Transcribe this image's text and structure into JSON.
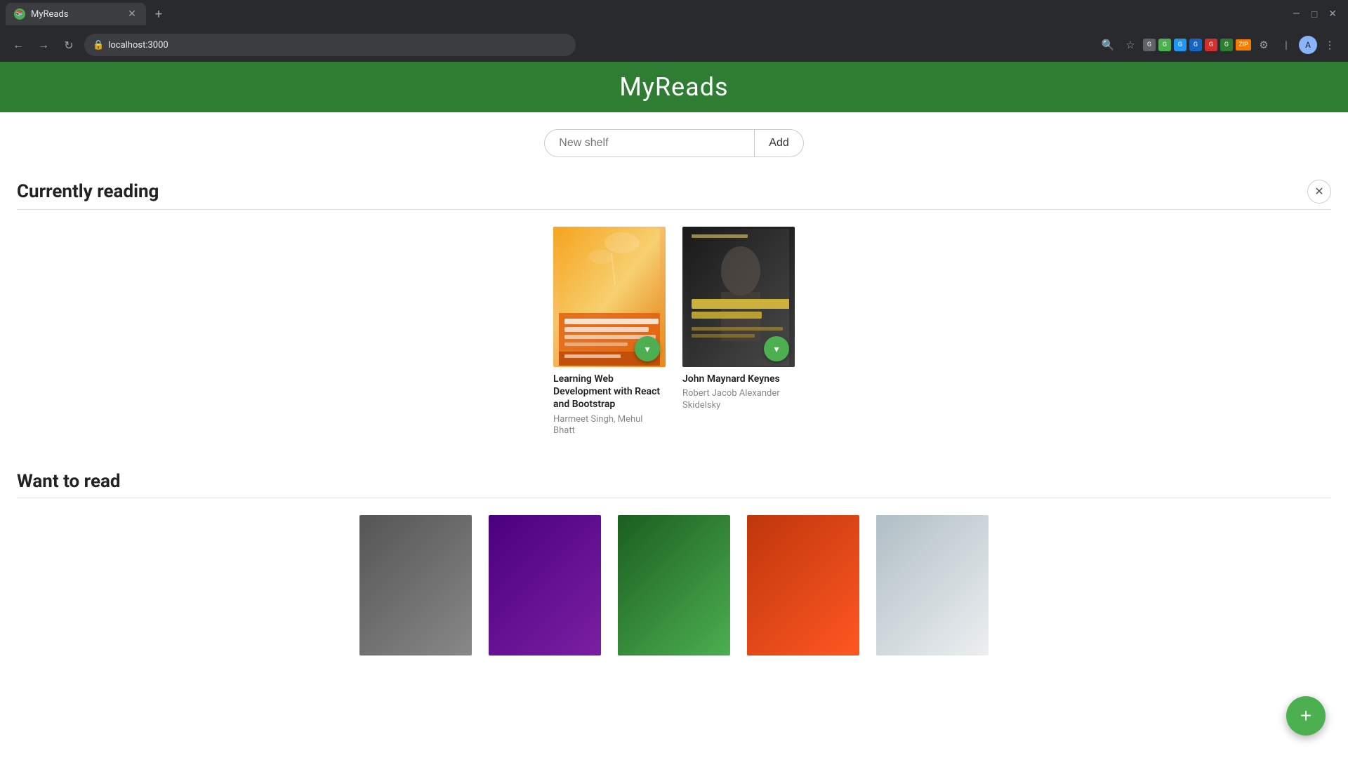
{
  "browser": {
    "tab_title": "MyReads",
    "tab_favicon": "📚",
    "address": "localhost:3000",
    "window_minimize": "—",
    "window_maximize": "□",
    "window_close": "✕"
  },
  "app": {
    "title": "MyReads",
    "header_bg": "#2e7d32"
  },
  "new_shelf": {
    "placeholder": "New shelf",
    "add_label": "Add"
  },
  "shelves": [
    {
      "id": "currently-reading",
      "title": "Currently reading",
      "books": [
        {
          "id": "book-1",
          "title": "Learning Web Development with React and Bootstrap",
          "author": "Harmeet Singh, Mehul Bhatt",
          "cover_style": "react"
        },
        {
          "id": "book-2",
          "title": "John Maynard Keynes",
          "author": "Robert Jacob Alexander Skidelsky",
          "cover_style": "keynes"
        }
      ]
    },
    {
      "id": "want-to-read",
      "title": "Want to read",
      "books": []
    }
  ],
  "fab": {
    "label": "+"
  },
  "icons": {
    "back": "←",
    "forward": "→",
    "refresh": "↻",
    "lock": "🔒",
    "star": "☆",
    "more": "⋮",
    "search": "🔍",
    "dropdown": "▾",
    "close": "✕"
  }
}
